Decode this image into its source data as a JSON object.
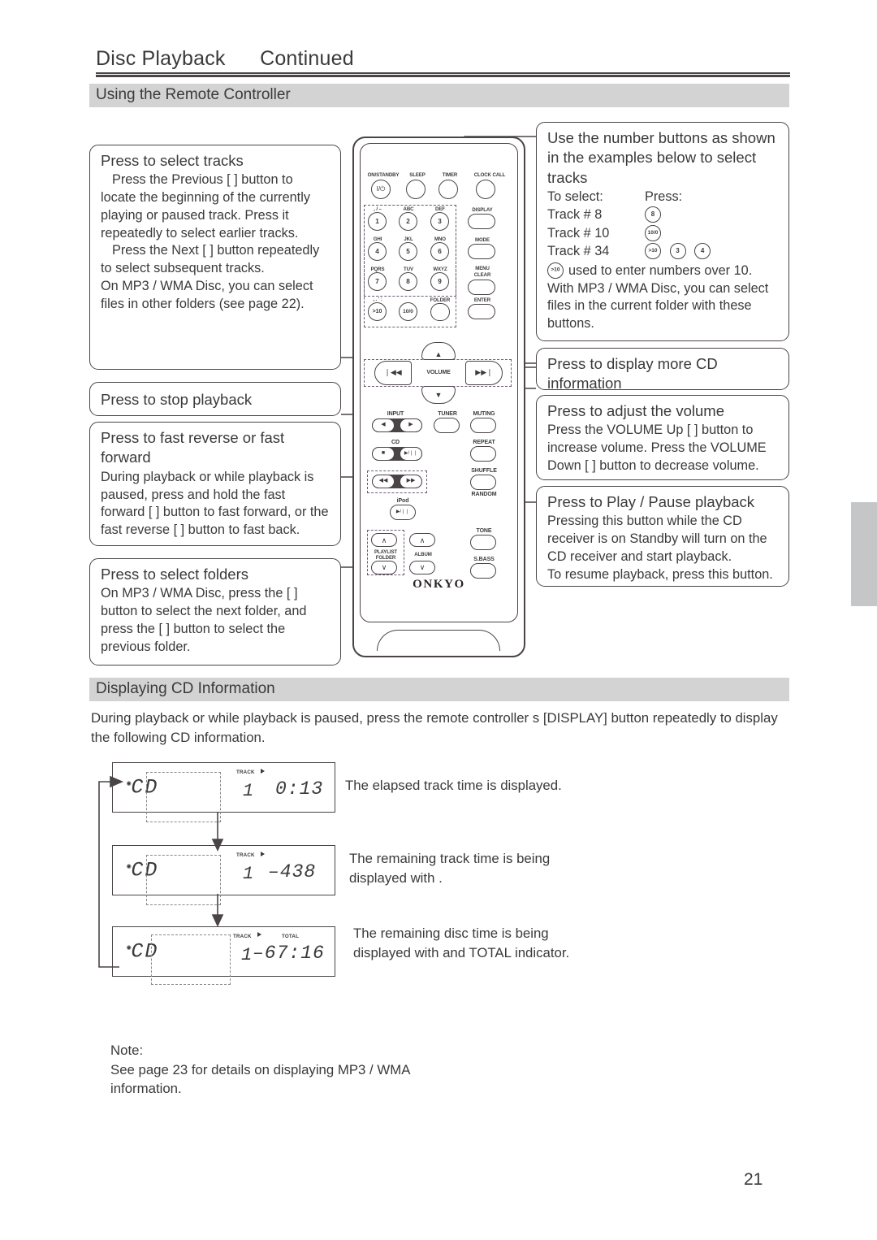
{
  "header": {
    "title": "Disc Playback",
    "continued": "Continued",
    "page_number": "21"
  },
  "sections": {
    "remote": "Using the Remote Controller",
    "cd_info": "Displaying CD Information"
  },
  "callouts": {
    "select_tracks": {
      "title": "Press to select tracks",
      "p1": "Press the Previous [        ] button to locate the beginning of the currently playing or paused track. Press it repeatedly to select earlier tracks.",
      "p2": "Press the Next [        ] button repeatedly to select subsequent tracks.",
      "p3": "On MP3 / WMA Disc, you can select files in other folders (see page 22)."
    },
    "stop": {
      "title": "Press to stop playback"
    },
    "fast_forward": {
      "title": "Press to fast reverse or fast forward",
      "p1": "During playback or while playback is paused, press and hold the fast forward [        ] button to fast forward, or the fast reverse [        ] button to fast back."
    },
    "folders": {
      "title": "Press to select folders",
      "p1": "On MP3 / WMA Disc, press the [  ] button to select the next folder, and press the [  ] button to select the previous folder."
    },
    "number_buttons": {
      "title": "Use the number buttons as shown in the examples below to select tracks",
      "col_select": "To select:",
      "col_press": "Press:",
      "rows": [
        {
          "label": "Track # 8",
          "buttons": [
            "8"
          ]
        },
        {
          "label": "Track # 10",
          "buttons": [
            "10/0"
          ]
        },
        {
          "label": "Track # 34",
          "buttons": [
            ">10",
            "3",
            "4"
          ]
        }
      ],
      "footnote_icon": ">10",
      "footnote": "used to enter numbers over 10.",
      "p2": "With MP3 / WMA Disc, you can select files in the current folder with these buttons."
    },
    "display_more": {
      "title": "Press to display more CD information"
    },
    "volume": {
      "title": "Press to adjust the volume",
      "p1": "Press the VOLUME Up [   ] button to increase volume. Press the VOLUME Down [   ] button to decrease volume."
    },
    "play_pause": {
      "title": "Press to Play / Pause playback",
      "p1": "Pressing this button while the CD receiver is on Standby will turn on the CD receiver and start playback.",
      "p2": "To resume playback, press this button."
    }
  },
  "remote": {
    "brand": "ONKYO",
    "top_row": [
      "ON/STANDBY",
      "SLEEP",
      "TIMER",
      "CLOCK CALL"
    ],
    "power_glyph": "I/⏻",
    "keypad_letters": [
      ", / –",
      "ABC",
      "DEF",
      "GHI",
      "JKL",
      "MNO",
      "PQRS",
      "TUV",
      "WXYZ",
      ", . ' :"
    ],
    "keypad_numbers": [
      "1",
      "2",
      "3",
      "4",
      "5",
      "6",
      "7",
      "8",
      "9",
      ">10",
      "10/0"
    ],
    "right_column": [
      "DISPLAY",
      "MODE",
      "MENU",
      "CLEAR",
      "ENTER"
    ],
    "folder_label": "FOLDER",
    "volume_label": "VOLUME",
    "prev_glyph": "❘◀◀",
    "next_glyph": "▶▶❘",
    "input_label": "INPUT",
    "tuner_label": "TUNER",
    "muting_label": "MUTING",
    "cd_label": "CD",
    "repeat_label": "REPEAT",
    "shuffle_label": "SHUFFLE",
    "random_label": "RANDOM",
    "ipod_label": "iPod",
    "playlist_label": "PLAYLIST",
    "folder2_label": "FOLDER",
    "album_label": "ALBUM",
    "tone_label": "TONE",
    "sbass_label": "S.BASS",
    "stop_glyph": "■",
    "playpause_glyph": "▶/❘❘",
    "rew_glyph": "◀◀",
    "ffwd_glyph": "▶▶",
    "left_glyph": "◀",
    "right_glyph": "▶",
    "up_glyph": "∧",
    "down_glyph": "∨"
  },
  "cd_info": {
    "intro": "During playback or while playback is paused, press the remote controller s [DISPLAY] button repeatedly to display the following CD information.",
    "displays": [
      {
        "source": "CD",
        "track_label": "TRACK",
        "track_no": "1",
        "value": "0:13",
        "total_label": "",
        "caption": "The elapsed track time is displayed."
      },
      {
        "source": "CD",
        "track_label": "TRACK",
        "track_no": "1",
        "value": "–438",
        "total_label": "",
        "caption": "The remaining track time is being displayed with   ."
      },
      {
        "source": "CD",
        "track_label": "TRACK",
        "track_no": "1",
        "value": "–67:16",
        "total_label": "TOTAL",
        "caption": "The remaining disc time is being displayed with     and TOTAL indicator."
      }
    ]
  },
  "note": {
    "label": "Note:",
    "text": "See page 23 for details on displaying MP3 / WMA information."
  }
}
